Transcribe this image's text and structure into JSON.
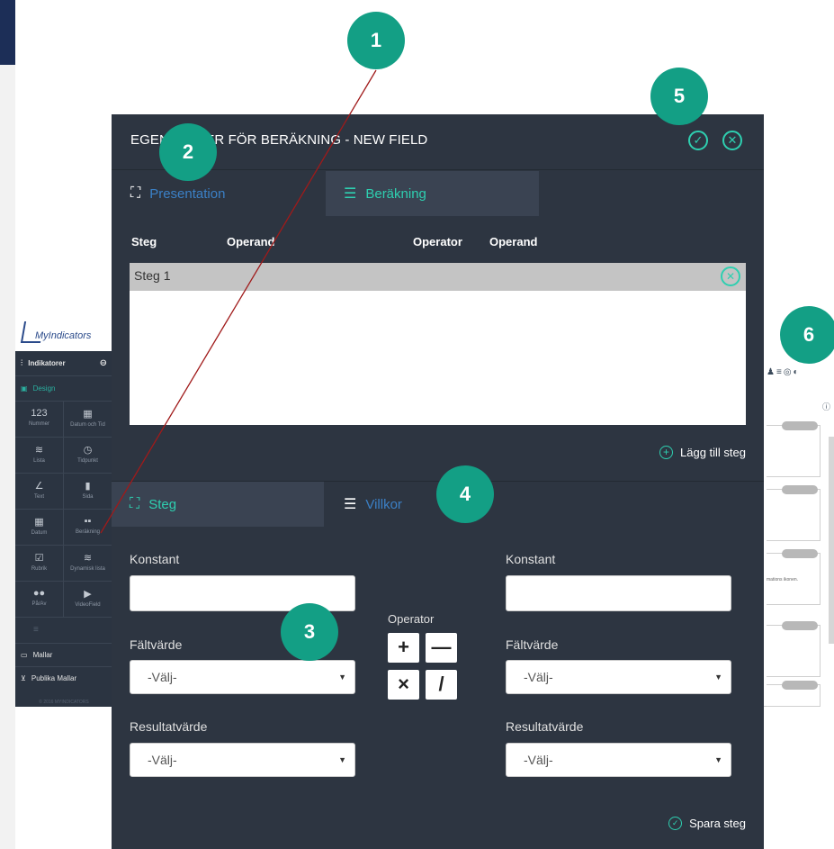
{
  "background_app": {
    "logo_text": "MyIndicators",
    "sidebar": {
      "header": "Indikatorer",
      "design_label": "Design",
      "cells": [
        {
          "glyph": "123",
          "label": "Nummer",
          "icon": "number-icon"
        },
        {
          "glyph": "▦",
          "label": "Datum och Tid",
          "icon": "calendar-icon"
        },
        {
          "glyph": "≋",
          "label": "Lista",
          "icon": "list-icon"
        },
        {
          "glyph": "◷",
          "label": "Tidpunkt",
          "icon": "clock-icon"
        },
        {
          "glyph": "∠",
          "label": "Text",
          "icon": "pen-icon"
        },
        {
          "glyph": "▮",
          "label": "Sida",
          "icon": "page-icon"
        },
        {
          "glyph": "▦",
          "label": "Datum",
          "icon": "calendar-icon"
        },
        {
          "glyph": "▪▪",
          "label": "Beräkning",
          "icon": "grid-icon"
        },
        {
          "glyph": "☑",
          "label": "Rubrik",
          "icon": "edit-icon"
        },
        {
          "glyph": "≋",
          "label": "Dynamisk lista",
          "icon": "dynamic-list-icon"
        },
        {
          "glyph": "●●",
          "label": "På/Av",
          "icon": "toggle-icon"
        },
        {
          "glyph": "▶",
          "label": "VideoField",
          "icon": "video-icon"
        }
      ],
      "items": [
        "Mallar",
        "Publika Mallar"
      ],
      "copyright": "© 2016 MYINDICATORS"
    },
    "card_text": "mations ikonen."
  },
  "modal": {
    "title": "EGENSKAPER FÖR BERÄKNING - NEW FIELD",
    "tabs_top": [
      "Presentation",
      "Beräkning"
    ],
    "columns": [
      "Steg",
      "Operand",
      "Operator",
      "Operand"
    ],
    "steps": [
      "Steg 1"
    ],
    "add_step_label": "Lägg till steg",
    "tabs_bottom": [
      "Steg",
      "Villkor"
    ],
    "left": {
      "konstant_label": "Konstant",
      "faltvarde_label": "Fältvärde",
      "faltvarde_value": "-Välj-",
      "resultatvarde_label": "Resultatvärde",
      "resultatvarde_value": "-Välj-"
    },
    "right": {
      "konstant_label": "Konstant",
      "faltvarde_label": "Fältvärde",
      "faltvarde_value": "-Välj-",
      "resultatvarde_label": "Resultatvärde",
      "resultatvarde_value": "-Välj-"
    },
    "operator_label": "Operator",
    "operators": [
      "+",
      "—",
      "×",
      "/"
    ],
    "save_step_label": "Spara steg"
  },
  "callouts": [
    "1",
    "2",
    "3",
    "4",
    "5",
    "6"
  ],
  "colors": {
    "modal_bg": "#2d3541",
    "accent": "#2ecfb0",
    "link_blue": "#3b80c6",
    "callout": "#139f85",
    "pointer_line": "#a01a1a"
  }
}
